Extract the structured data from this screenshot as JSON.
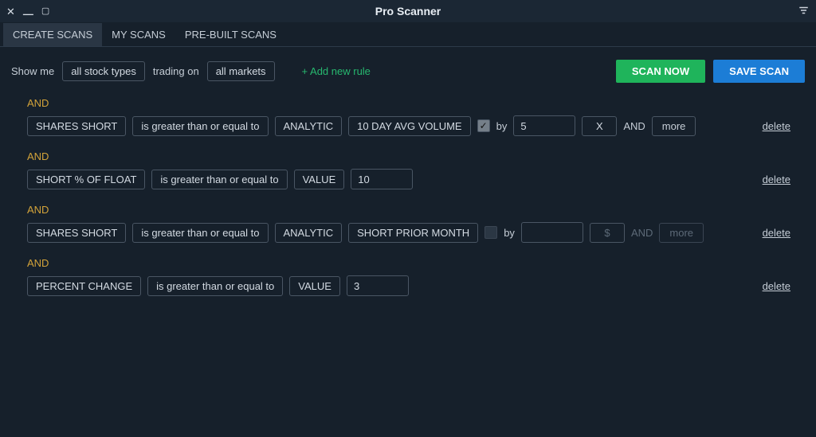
{
  "window": {
    "title": "Pro Scanner"
  },
  "tabs": [
    {
      "label": "CREATE SCANS",
      "active": true
    },
    {
      "label": "MY SCANS",
      "active": false
    },
    {
      "label": "PRE-BUILT SCANS",
      "active": false
    }
  ],
  "topbar": {
    "show_me": "Show me",
    "stock_type": "all stock types",
    "trading_on": "trading on",
    "market": "all markets",
    "add_rule": "+ Add new rule"
  },
  "buttons": {
    "scan_now": "SCAN NOW",
    "save_scan": "SAVE SCAN"
  },
  "and_label": "AND",
  "delete_label": "delete",
  "by_label": "by",
  "more_label": "more",
  "rules": [
    {
      "metric": "SHARES SHORT",
      "operator": "is greater than or equal to",
      "mode": "ANALYTIC",
      "target": "10 DAY AVG VOLUME",
      "checked": true,
      "factor": "5",
      "unit": "X",
      "more_enabled": true
    },
    {
      "metric": "SHORT % OF FLOAT",
      "operator": "is greater than or equal to",
      "mode": "VALUE",
      "value": "10"
    },
    {
      "metric": "SHARES SHORT",
      "operator": "is greater than or equal to",
      "mode": "ANALYTIC",
      "target": "SHORT PRIOR MONTH",
      "checked": false,
      "factor": "",
      "unit": "$",
      "more_enabled": false
    },
    {
      "metric": "PERCENT CHANGE",
      "operator": "is greater than or equal to",
      "mode": "VALUE",
      "value": "3"
    }
  ]
}
